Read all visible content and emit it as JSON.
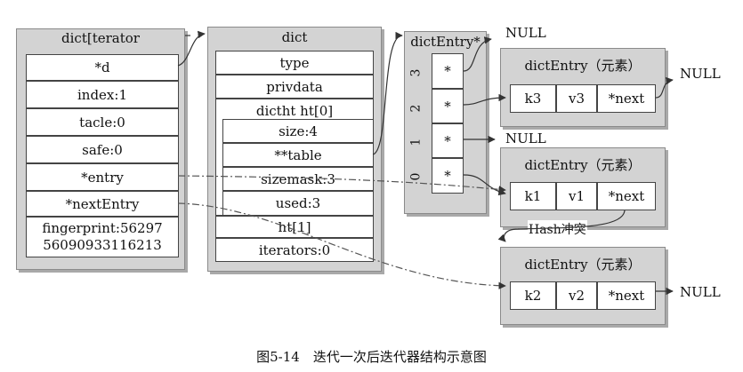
{
  "iterator": {
    "title": "dict[terator",
    "fields": [
      "*d",
      "index:1",
      "tacle:0",
      "safe:0",
      "*entry",
      "*nextEntry"
    ],
    "fingerprint_line1": "fingerprint:56297",
    "fingerprint_line2": "56090933116213"
  },
  "dict": {
    "title": "dict",
    "type": "type",
    "privdata": "privdata",
    "ht0_title": "dictht ht[0]",
    "ht0_fields": [
      "size:4",
      "**table",
      "sizemask:3",
      "used:3"
    ],
    "ht1": "ht[1]",
    "iterators": "iterators:0"
  },
  "table": {
    "title": "dictEntry*",
    "indices": [
      "3",
      "2",
      "1",
      "0"
    ],
    "slot": "*"
  },
  "entries": [
    {
      "title": "dictEntry（元素）",
      "key": "k3",
      "val": "v3",
      "next": "*next"
    },
    {
      "title": "dictEntry（元素）",
      "key": "k1",
      "val": "v1",
      "next": "*next"
    },
    {
      "title": "dictEntry（元素）",
      "key": "k2",
      "val": "v2",
      "next": "*next"
    }
  ],
  "null_label": "NULL",
  "hash_conflict": "Hash冲突",
  "caption": "图5-14　迭代一次后迭代器结构示意图"
}
